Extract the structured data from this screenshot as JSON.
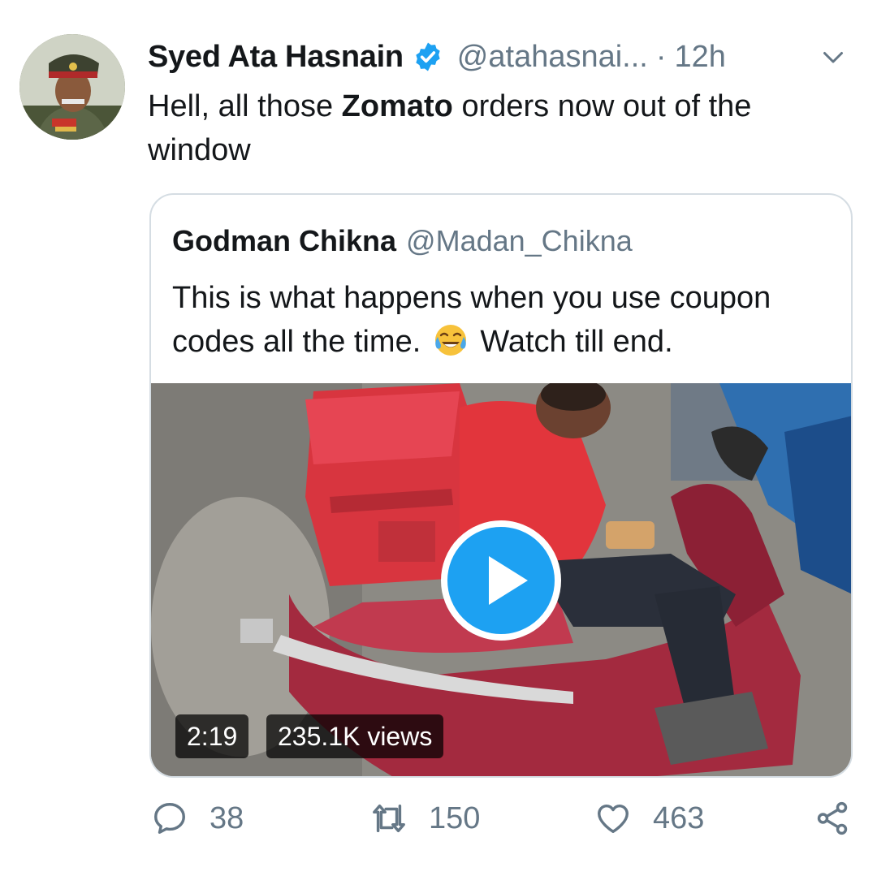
{
  "tweet": {
    "author_name": "Syed Ata Hasnain",
    "author_handle": "@atahasnai...",
    "separator": "·",
    "time": "12h",
    "text_before": "Hell, all those ",
    "text_bold": "Zomato",
    "text_after": " orders now out of the window",
    "icons": {
      "verified": "verified-badge-icon",
      "menu": "chevron-down-icon"
    },
    "colors": {
      "verified": "#1da1f2",
      "secondary": "#657786"
    }
  },
  "quoted_tweet": {
    "author_name": "Godman Chikna",
    "author_handle": "@Madan_Chikna",
    "text_before": "This is what happens when you use coupon codes all the time. ",
    "emoji": "😂",
    "text_after": " Watch till end.",
    "video": {
      "duration": "2:19",
      "views": "235.1K views",
      "play_icon": "play-icon"
    }
  },
  "actions": {
    "replies": "38",
    "retweets": "150",
    "likes": "463",
    "icons": [
      "reply-icon",
      "retweet-icon",
      "like-icon",
      "share-icon"
    ]
  }
}
